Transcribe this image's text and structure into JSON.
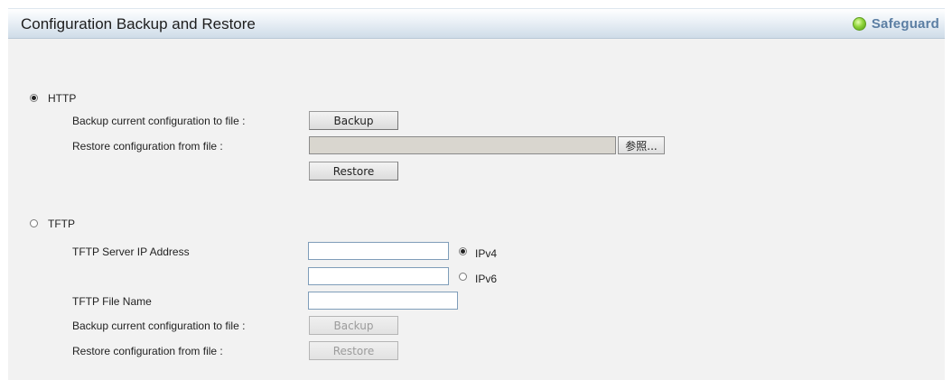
{
  "header": {
    "title": "Configuration Backup and Restore",
    "badge_label": "Safeguard"
  },
  "http": {
    "label": "HTTP",
    "selected": true,
    "backup_label": "Backup current configuration to file :",
    "backup_button": "Backup",
    "restore_label": "Restore configuration from file :",
    "file_value": "",
    "browse_button": "参照...",
    "restore_button": "Restore"
  },
  "tftp": {
    "label": "TFTP",
    "selected": false,
    "server_ip_label": "TFTP Server IP Address",
    "ipv4_value": "",
    "ipv4_label": "IPv4",
    "ipv4_selected": true,
    "ipv6_value": "",
    "ipv6_label": "IPv6",
    "ipv6_selected": false,
    "file_name_label": "TFTP File Name",
    "file_name_value": "",
    "backup_label": "Backup current configuration to file :",
    "backup_button": "Backup",
    "restore_label": "Restore configuration from file :",
    "restore_button": "Restore"
  }
}
